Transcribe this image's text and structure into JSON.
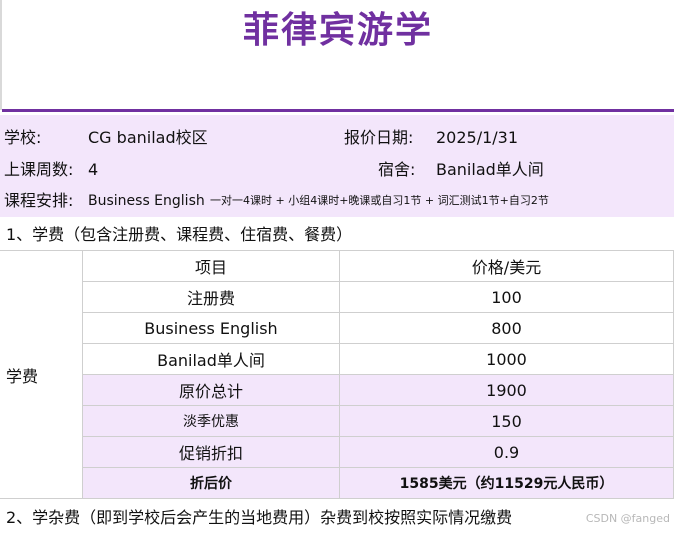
{
  "title": "菲律宾游学",
  "info": {
    "school_label": "学校:",
    "school_value": "CG banilad校区",
    "quote_date_label": "报价日期:",
    "quote_date_value": "2025/1/31",
    "weeks_label": "上课周数:",
    "weeks_value": "4",
    "dorm_label": "宿舍:",
    "dorm_value": "Banilad单人间",
    "course_label": "课程安排:",
    "course_value": "Business English",
    "course_detail": "一对一4课时 + 小组4课时+晚课或自习1节 + 词汇测试1节+自习2节"
  },
  "section1_title": "1、学费（包含注册费、课程费、住宿费、餐费）",
  "fees": {
    "side_label": "学费",
    "header": {
      "item": "项目",
      "price": "价格/美元"
    },
    "rows": [
      {
        "item": "注册费",
        "price": "100"
      },
      {
        "item": "Business English",
        "price": "800"
      },
      {
        "item": "Banilad单人间",
        "price": "1000"
      },
      {
        "item": "原价总计",
        "price": "1900"
      },
      {
        "item": "淡季优惠",
        "price": "150"
      },
      {
        "item": "促销折扣",
        "price": "0.9"
      },
      {
        "item": "折后价",
        "price": "1585美元（约11529元人民币）"
      }
    ]
  },
  "section2_title": "2、学杂费（即到学校后会产生的当地费用）杂费到校按照实际情况缴费",
  "watermark": "CSDN @fanged"
}
